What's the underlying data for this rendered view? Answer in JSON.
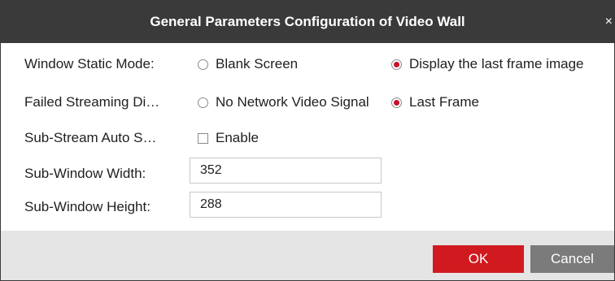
{
  "dialog": {
    "title": "General Parameters Configuration of Video Wall",
    "close_glyph": "×"
  },
  "form": {
    "window_static_mode": {
      "label": "Window Static Mode:",
      "options": [
        {
          "label": "Blank Screen",
          "selected": false
        },
        {
          "label": "Display the last frame image",
          "selected": true
        }
      ]
    },
    "failed_streaming": {
      "label": "Failed Streaming Di…",
      "options": [
        {
          "label": "No Network Video Signal",
          "selected": false
        },
        {
          "label": "Last Frame",
          "selected": true
        }
      ]
    },
    "sub_stream_auto": {
      "label": "Sub-Stream Auto S…",
      "checkbox_label": "Enable",
      "checked": false
    },
    "sub_window_width": {
      "label": "Sub-Window Width:",
      "value": "352"
    },
    "sub_window_height": {
      "label": "Sub-Window Height:",
      "value": "288"
    }
  },
  "footer": {
    "ok_label": "OK",
    "cancel_label": "Cancel"
  },
  "colors": {
    "titlebar": "#3a3a3a",
    "accent": "#d11a1f",
    "cancel": "#7b7b7b",
    "footer": "#e5e5e5"
  }
}
